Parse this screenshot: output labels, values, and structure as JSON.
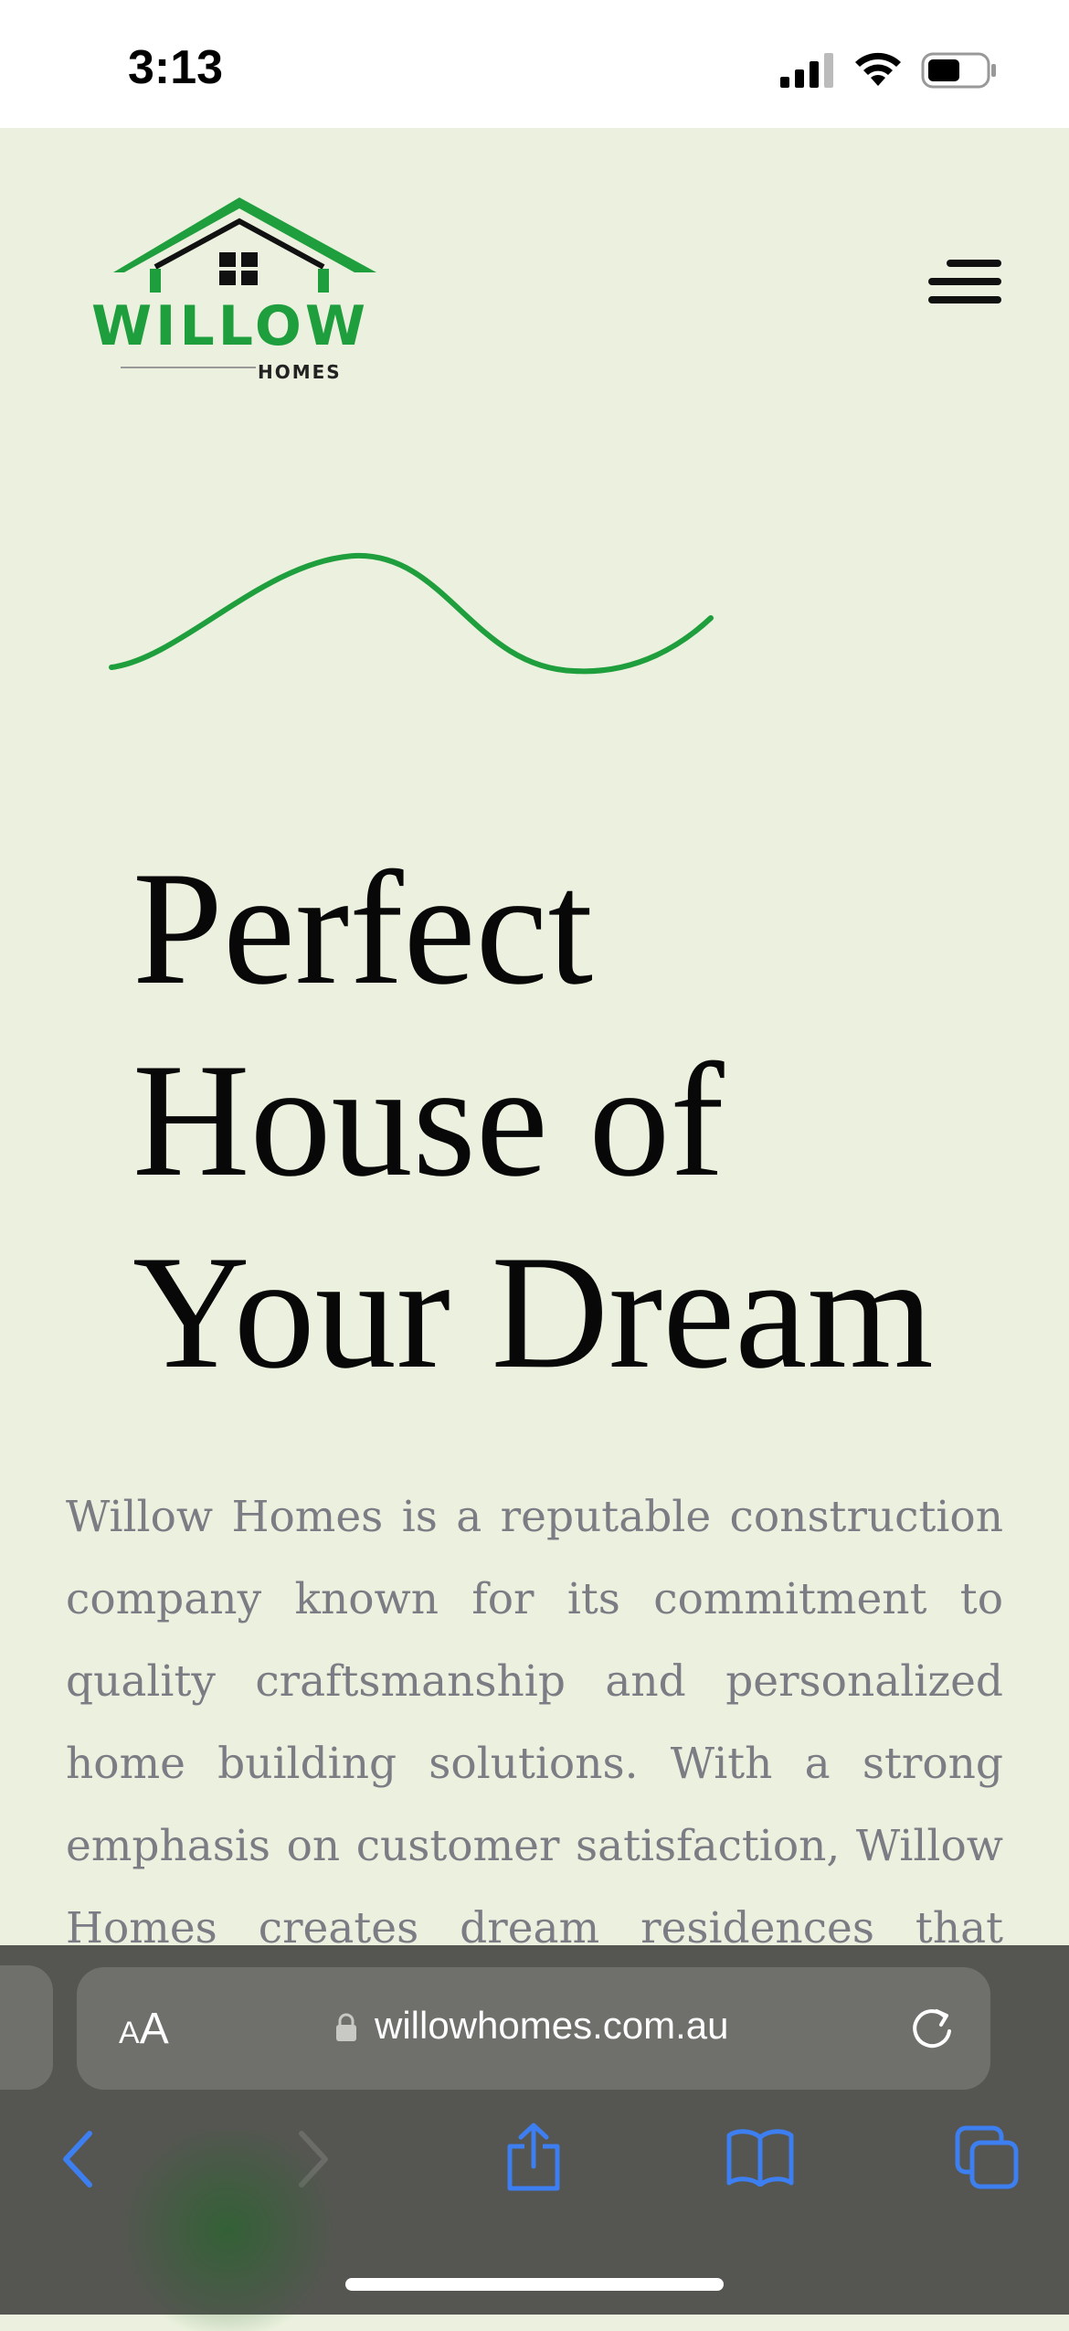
{
  "status_bar": {
    "time": "3:13",
    "signal": "signal-bars-icon",
    "wifi": "wifi-icon",
    "battery": "battery-icon"
  },
  "header": {
    "logo_word": "WILLOW",
    "logo_sub": "HOMES",
    "menu_icon": "hamburger-menu-icon"
  },
  "hero": {
    "headline_lines": [
      "Perfect",
      "House of",
      "Your Dream"
    ],
    "intro": "Willow Homes is a reputable construction company known for its commitment to quality craftsmanship and personalized home building solutions. With a strong emphasis on customer satisfaction, Willow Homes creates dream residences that reflect"
  },
  "browser": {
    "aa_small": "A",
    "aa_big": "A",
    "url": "willowhomes.com.au",
    "icons": {
      "back": "back-chevron-icon",
      "forward": "forward-chevron-icon",
      "share": "share-icon",
      "bookmarks": "bookmarks-book-icon",
      "tabs": "tabs-icon",
      "reload": "reload-icon",
      "lock": "lock-icon"
    }
  },
  "colors": {
    "background": "#ebf1de",
    "brand_green": "#1e9e3c",
    "headline": "#080808",
    "body_text": "#7b7c84",
    "toolbar": "#555651",
    "toolbar_pill": "#6f706b",
    "safari_blue": "#3d7ef0"
  }
}
